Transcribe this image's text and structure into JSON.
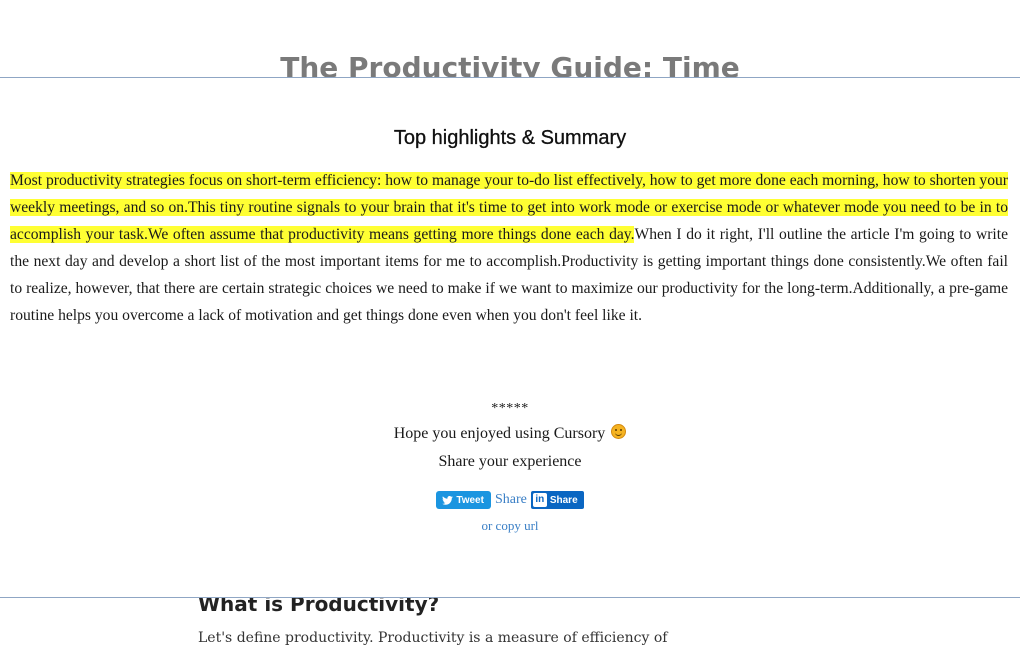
{
  "background": {
    "article_title": "The Productivity Guide: Time",
    "section_heading": "What is Productivity?",
    "paragraph_fragment": "Let's define productivity. Productivity is a measure of efficiency of"
  },
  "summary": {
    "heading": "Top highlights & Summary",
    "highlighted_1": "Most productivity strategies focus on short-term efficiency: how to manage your to-do list effectively, how to get more done each morning, how to shorten your weekly meetings, and so on.",
    "highlighted_2": "This tiny routine signals to your brain that it's time to get into work mode or exercise mode or whatever mode you need to be in to accomplish your task.",
    "highlighted_3": "We often assume that productivity means getting more things done each day.",
    "plain_text": "When I do it right, I'll outline the article I'm going to write the next day and develop a short list of the most important items for me to accomplish.Productivity is getting important things done consistently.We often fail to realize, however, that there are certain strategic choices we need to make if we want to maximize our productivity for the long-term.Additionally, a pre-game routine helps you overcome a lack of motivation and get things done even when you don't feel like it."
  },
  "footer": {
    "separator": "*****",
    "thanks": "Hope you enjoyed using Cursory",
    "emoji_icon": "smile-emoji-icon",
    "share_prompt": "Share your experience",
    "tweet_label": "Tweet",
    "share_label": "Share",
    "linkedin_label": "Share",
    "linkedin_glyph": "in",
    "copy_url_label": "or copy url"
  },
  "colors": {
    "highlight": "#ffff33",
    "link": "#3a7fc6",
    "twitter": "#1b95e0",
    "linkedin": "#0a66c2",
    "overlay_border": "#8fa6c4"
  }
}
